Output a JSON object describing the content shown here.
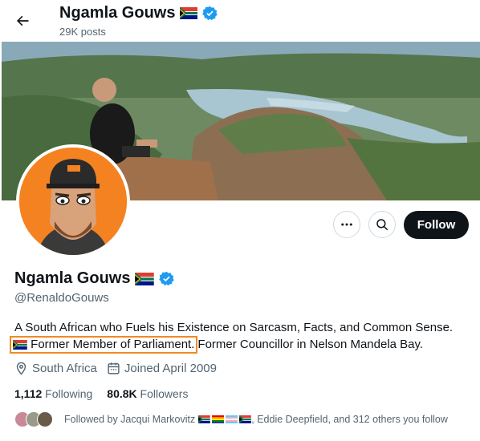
{
  "header": {
    "title": "Ngamla Gouws",
    "posts": "29K posts"
  },
  "profile": {
    "name": "Ngamla Gouws",
    "handle": "@RenaldoGouws",
    "bio_line1": "A South African who Fuels his Existence on Sarcasm, Facts, and Common Sense.",
    "bio_highlight": "Former Member of Parliament.",
    "bio_rest": "Former Councillor in Nelson Mandela Bay.",
    "location": "South Africa",
    "joined": "Joined April 2009",
    "following_count": "1,112",
    "following_label": "Following",
    "followers_count": "80.8K",
    "followers_label": "Followers",
    "followed_prefix": "Followed by Jacqui Markovitz",
    "followed_rest": ", Eddie Deepfield, and 312 others you follow"
  },
  "actions": {
    "follow": "Follow"
  },
  "colors": {
    "verified": "#1d9bf0",
    "highlight": "#f08a24",
    "avatar_bg": "#f58220"
  },
  "icons": [
    "back-arrow-icon",
    "verified-badge-icon",
    "sa-flag-icon",
    "more-icon",
    "search-icon",
    "location-icon",
    "calendar-icon"
  ]
}
